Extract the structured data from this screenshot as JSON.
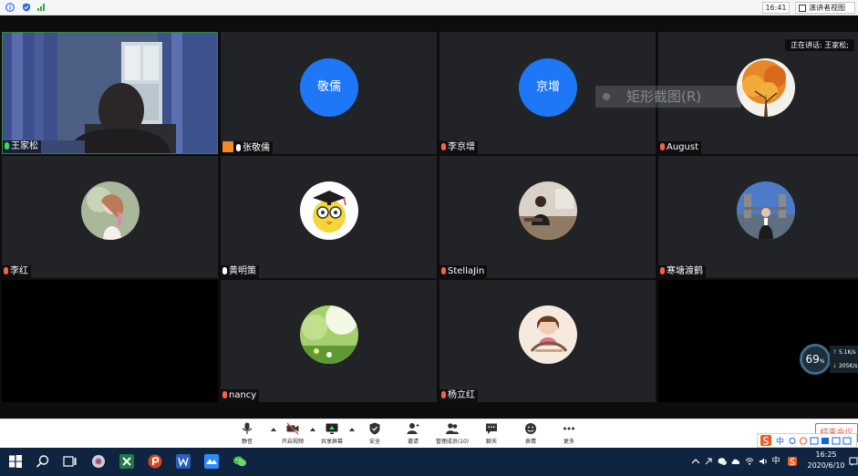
{
  "top_bar": {
    "clock": "16:41",
    "view_button": "演讲者视图"
  },
  "meeting": {
    "speaking_label": "正在讲话: 王家松;",
    "ghost_menu_text": "矩形截图(R)",
    "participants": [
      {
        "name": "王家松",
        "mic": "on",
        "avatar_type": "video"
      },
      {
        "name": "张敬儒",
        "mic": "white",
        "avatar_type": "text",
        "avatar_text": "敬儒",
        "host": true
      },
      {
        "name": "李京增",
        "mic": "off",
        "avatar_type": "text",
        "avatar_text": "京增"
      },
      {
        "name": "August",
        "mic": "off",
        "avatar_type": "photo-autumn"
      },
      {
        "name": "李红",
        "mic": "off",
        "avatar_type": "photo-girl"
      },
      {
        "name": "黄明策",
        "mic": "white",
        "avatar_type": "photo-cartoon"
      },
      {
        "name": "StellaJin",
        "mic": "off",
        "avatar_type": "photo-room"
      },
      {
        "name": "寒塘渡鹤",
        "mic": "off",
        "avatar_type": "photo-bridge"
      },
      {
        "name": "nancy",
        "mic": "off",
        "avatar_type": "photo-nature"
      },
      {
        "name": "杨立红",
        "mic": "off",
        "avatar_type": "photo-doll"
      }
    ]
  },
  "stats": {
    "percent": "69",
    "percent_unit": "%",
    "upload": "5.1K/s",
    "download": "205K/s"
  },
  "toolbar": {
    "mute": "静音",
    "video": "开启视频",
    "share": "共享屏幕",
    "security": "安全",
    "invite": "邀请",
    "participants": "管理成员(10)",
    "chat": "聊天",
    "reactions": "表情",
    "more": "更多",
    "end": "结束会议"
  },
  "taskbar": {
    "time": "16:25",
    "date": "2020/6/10",
    "ime": "中"
  },
  "colors": {
    "avatar_blue": "#1e77f7",
    "tile_bg": "#222326",
    "end_red": "#e5534b",
    "taskbar": "#0f2440"
  }
}
